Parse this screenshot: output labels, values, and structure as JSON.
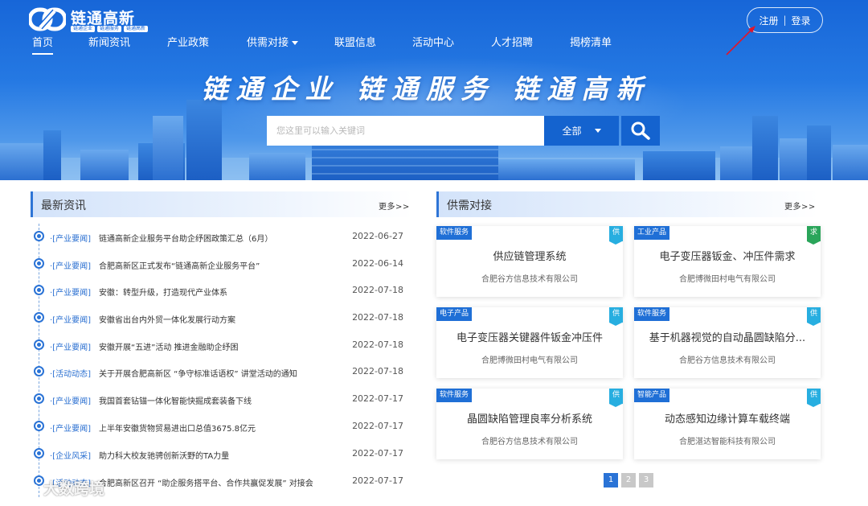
{
  "brand": {
    "name": "链通高新",
    "tags": [
      "链通企业",
      "链通服务",
      "链通高新"
    ],
    "primary_color": "#1766d8",
    "logo_icon": "chain-link-logo"
  },
  "nav": {
    "items": [
      {
        "label": "首页",
        "active": true
      },
      {
        "label": "新闻资讯"
      },
      {
        "label": "产业政策"
      },
      {
        "label": "供需对接",
        "has_dropdown": true
      },
      {
        "label": "联盟信息"
      },
      {
        "label": "活动中心"
      },
      {
        "label": "人才招聘"
      },
      {
        "label": "揭榜清单"
      }
    ]
  },
  "auth": {
    "register": "注册",
    "separator": "|",
    "login": "登录"
  },
  "hero": {
    "slogan": "链通企业 链通服务 链通高新"
  },
  "search": {
    "placeholder": "您这里可以输入关键词",
    "value": "",
    "select_value": "全部",
    "button_icon": "search-icon"
  },
  "news": {
    "title": "最新资讯",
    "more": "更多>>",
    "items": [
      {
        "category": "·[产业要闻]",
        "title": "链通高新企业服务平台助企纾困政策汇总（6月）",
        "date": "2022-06-27"
      },
      {
        "category": "·[产业要闻]",
        "title": "合肥高新区正式发布“链通高新企业服务平台”",
        "date": "2022-06-14"
      },
      {
        "category": "·[产业要闻]",
        "title": "安徽：转型升级，打造现代产业体系",
        "date": "2022-07-18"
      },
      {
        "category": "·[产业要闻]",
        "title": "安徽省出台内外贸一体化发展行动方案",
        "date": "2022-07-18"
      },
      {
        "category": "·[产业要闻]",
        "title": "安徽开展“五进”活动 推进金融助企纾困",
        "date": "2022-07-18"
      },
      {
        "category": "·[活动动态]",
        "title": "关于开展合肥高新区 “争守标准话语权” 讲堂活动的通知",
        "date": "2022-07-18"
      },
      {
        "category": "·[产业要闻]",
        "title": "我国首套钻锚一体化智能快掘成套装备下线",
        "date": "2022-07-17"
      },
      {
        "category": "·[产业要闻]",
        "title": "上半年安徽货物贸易进出口总值3675.8亿元",
        "date": "2022-07-17"
      },
      {
        "category": "·[企业风采]",
        "title": "助力科大校友驰骋创新沃野的TA力量",
        "date": "2022-07-17"
      },
      {
        "category": "·[活动动态]",
        "title": "合肥高新区召开 “助企服务搭平台、合作共赢促发展” 对接会",
        "date": "2022-07-17"
      }
    ]
  },
  "supply": {
    "title": "供需对接",
    "more": "更多>>",
    "cards": [
      {
        "category": "软件服务",
        "badge": "供",
        "badge_type": "supply",
        "title": "供应链管理系统",
        "company": "合肥谷方信息技术有限公司"
      },
      {
        "category": "工业产品",
        "badge": "求",
        "badge_type": "demand",
        "title": "电子变压器钣金、冲压件需求",
        "company": "合肥博微田村电气有限公司"
      },
      {
        "category": "电子产品",
        "badge": "供",
        "badge_type": "supply",
        "title": "电子变压器关键器件钣金冲压件",
        "company": "合肥博微田村电气有限公司"
      },
      {
        "category": "软件服务",
        "badge": "供",
        "badge_type": "supply",
        "title": "基于机器视觉的自动晶圆缺陷分...",
        "company": "合肥谷方信息技术有限公司"
      },
      {
        "category": "软件服务",
        "badge": "供",
        "badge_type": "supply",
        "title": "晶圆缺陷管理良率分析系统",
        "company": "合肥谷方信息技术有限公司"
      },
      {
        "category": "智能产品",
        "badge": "供",
        "badge_type": "supply",
        "title": "动态感知边缘计算车载终端",
        "company": "合肥湛达智能科技有限公司"
      }
    ],
    "pages": [
      "1",
      "2",
      "3"
    ],
    "current_page": 1
  },
  "watermark": {
    "text": "大数跨境"
  }
}
